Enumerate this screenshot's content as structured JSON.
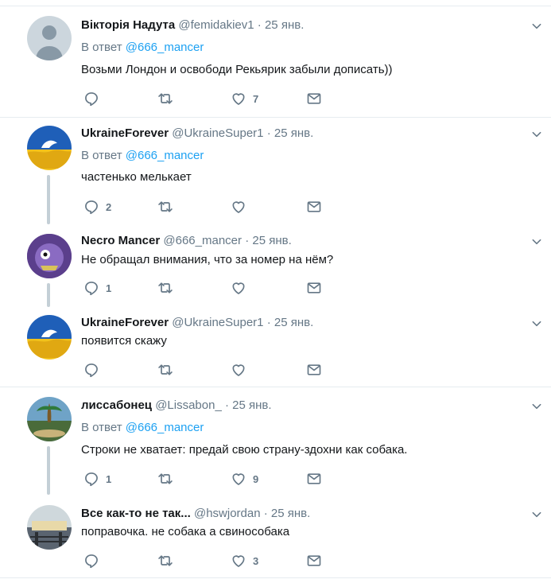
{
  "reply_prefix": "В ответ",
  "tweets": [
    {
      "name": "Вікторія Надута",
      "handle": "@femidakiev1",
      "time": "25 янв.",
      "reply_to": "@666_mancer",
      "text": "Возьми Лондон и освободи Рекьярик забыли дописать))",
      "replies": "",
      "retweets": "",
      "likes": "7"
    },
    {
      "name": "UkraineForever",
      "handle": "@UkraineSuper1",
      "time": "25 янв.",
      "reply_to": "@666_mancer",
      "text": "частенько мелькает",
      "replies": "2",
      "retweets": "",
      "likes": ""
    },
    {
      "name": "Necro Mancer",
      "handle": "@666_mancer",
      "time": "25 янв.",
      "reply_to": "",
      "text": "Не обращал внимания, что за номер на нём?",
      "replies": "1",
      "retweets": "",
      "likes": ""
    },
    {
      "name": "UkraineForever",
      "handle": "@UkraineSuper1",
      "time": "25 янв.",
      "reply_to": "",
      "text": "появится скажу",
      "replies": "",
      "retweets": "",
      "likes": ""
    },
    {
      "name": "лиссабонец",
      "handle": "@Lissabon_",
      "time": "25 янв.",
      "reply_to": "@666_mancer",
      "text": "Строки не хватает: предай свою страну-здохни как собака.",
      "replies": "1",
      "retweets": "",
      "likes": "9"
    },
    {
      "name": "Все как-то не так...",
      "handle": "@hswjordan",
      "time": "25 янв.",
      "reply_to": "",
      "text": "поправочка. не собака а свинособака",
      "replies": "",
      "retweets": "",
      "likes": "3"
    }
  ],
  "icons": {
    "reply": "reply-icon",
    "retweet": "retweet-icon",
    "like": "heart-icon",
    "dm": "envelope-icon",
    "more": "chevron-down-icon"
  },
  "colors": {
    "mention": "#1da1f2",
    "secondary": "#657786",
    "divider": "#e6ecf0",
    "thread_line": "#c4cfd6"
  }
}
